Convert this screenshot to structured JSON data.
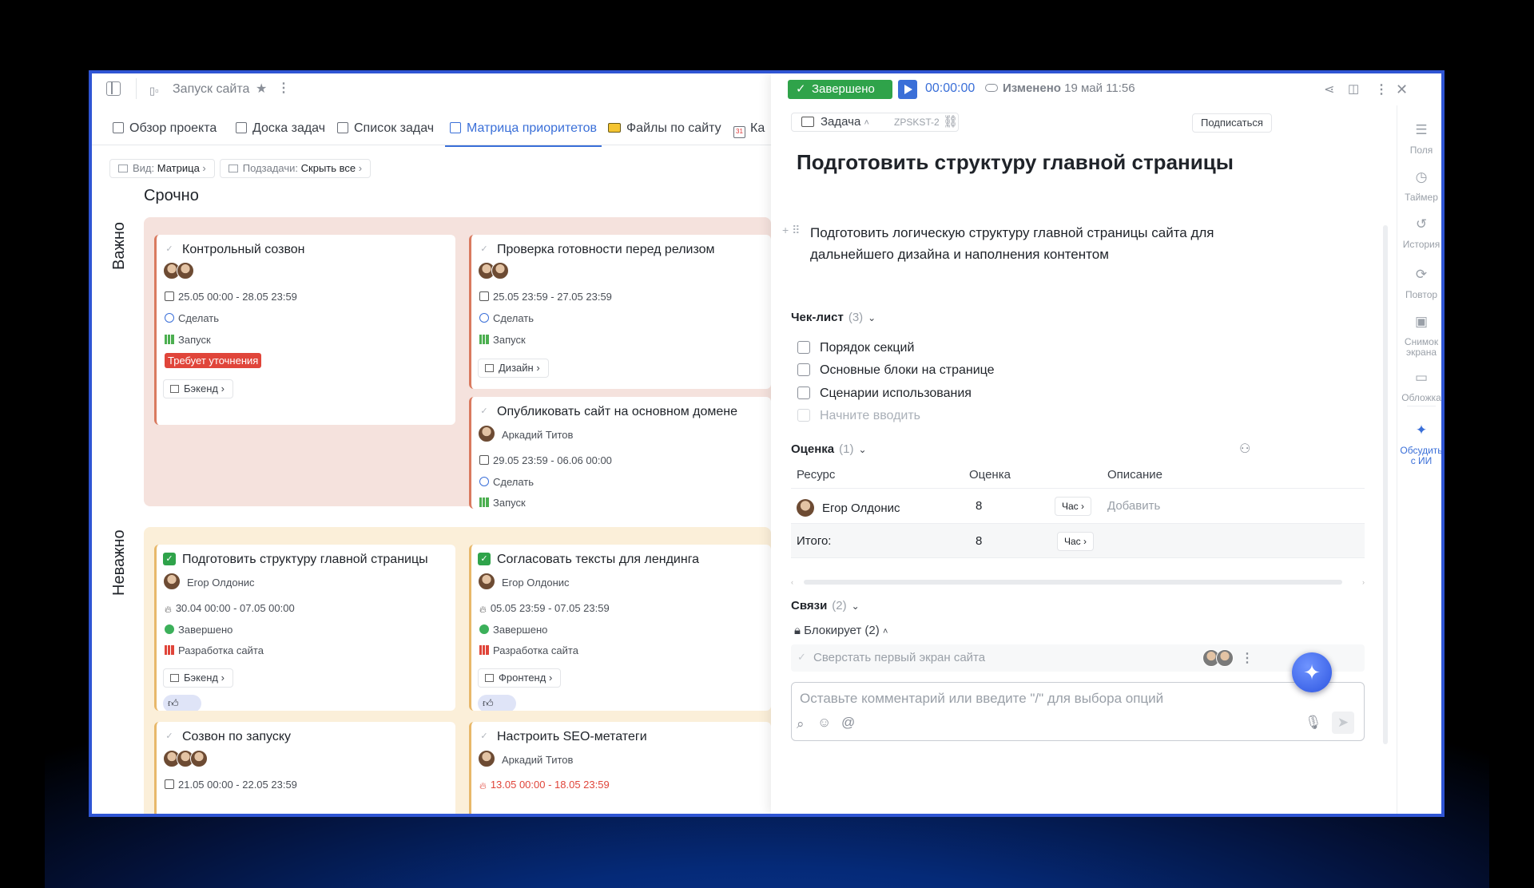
{
  "topbar": {
    "title": "Запуск сайта"
  },
  "tabs": [
    {
      "label": "Обзор проекта"
    },
    {
      "label": "Доска задач"
    },
    {
      "label": "Список задач"
    },
    {
      "label": "Матрица приоритетов"
    },
    {
      "label": "Файлы по сайту"
    },
    {
      "label": "Ка"
    }
  ],
  "filters": {
    "view_label": "Вид:",
    "view_value": "Матрица",
    "sub_label": "Подзадачи:",
    "sub_value": "Скрыть все"
  },
  "matrix": {
    "column": "Срочно",
    "rows": [
      "Важно",
      "Неважно"
    ],
    "cards": [
      {
        "title": "Контрольный созвон",
        "date": "25.05 00:00 - 28.05 23:59",
        "status": "Сделать",
        "stage": "Запуск",
        "tag": "Требует уточнения",
        "chip": "Бэкенд"
      },
      {
        "title": "Проверка готовности перед релизом",
        "date": "25.05 23:59 - 27.05 23:59",
        "status": "Сделать",
        "stage": "Запуск",
        "chip": "Дизайн"
      },
      {
        "title": "Опубликовать сайт на основном домене",
        "assignee": "Аркадий Титов",
        "date": "29.05 23:59 - 06.06 00:00",
        "status": "Сделать",
        "stage": "Запуск"
      },
      {
        "title": "Подготовить структуру главной страницы",
        "assignee": "Егор Олдонис",
        "date": "30.04 00:00 - 07.05 00:00",
        "status": "Завершено",
        "stage": "Разработка сайта",
        "chip": "Бэкенд"
      },
      {
        "title": "Согласовать тексты для лендинга",
        "assignee": "Егор Олдонис",
        "date": "05.05 23:59 - 07.05 23:59",
        "status": "Завершено",
        "stage": "Разработка сайта",
        "chip": "Фронтенд"
      },
      {
        "title": "Созвон по запуску",
        "date": "21.05 00:00 - 22.05 23:59"
      },
      {
        "title": "Настроить SEO-метатеги",
        "assignee": "Аркадий Титов",
        "date": "13.05 00:00 - 18.05 23:59"
      }
    ]
  },
  "task": {
    "status": "Завершено",
    "timer": "00:00:00",
    "changed_label": "Изменено",
    "changed_date": "19 май 11:56",
    "type": "Задача",
    "code": "ZPSKST-2",
    "subscribe": "Подписаться",
    "title": "Подготовить структуру главной страницы",
    "description": "Подготовить логическую структуру главной страницы сайта для дальнейшего дизайна и наполнения контентом",
    "checklist": {
      "label": "Чек-лист",
      "count": "(3)",
      "items": [
        "Порядок секций",
        "Основные блоки на странице",
        "Сценарии использования"
      ],
      "placeholder": "Начните вводить"
    },
    "estimate": {
      "label": "Оценка",
      "count": "(1)",
      "headers": [
        "Ресурс",
        "Оценка",
        "Описание"
      ],
      "row": {
        "resource": "Егор Олдонис",
        "value": "8",
        "unit": "Час",
        "desc": "Добавить"
      },
      "total": {
        "label": "Итого:",
        "value": "8",
        "unit": "Час"
      }
    },
    "links": {
      "label": "Связи",
      "count": "(2)",
      "blocks_label": "Блокирует (2)",
      "blocked_task": "Сверстать первый экран сайта"
    },
    "comment_placeholder": "Оставьте комментарий или введите \"/\" для выбора опций"
  },
  "sidebar": {
    "items": [
      "Поля",
      "Таймер",
      "История",
      "Повтор",
      "Снимок экрана",
      "Обложка",
      "Обсудить с ИИ"
    ]
  },
  "colors": {
    "accent": "#3a6fd8",
    "done": "#2fa34a",
    "urgent_tag": "#e0453a",
    "zone_important": "#f5e2dd",
    "zone_unimportant": "#fbefd9",
    "frame": "#2f55d4"
  }
}
